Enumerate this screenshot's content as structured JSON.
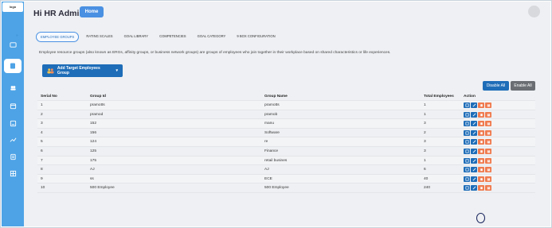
{
  "brand": {
    "label": "logo"
  },
  "header": {
    "title": "Hi HR Admin",
    "home_label": "Home"
  },
  "tabs": [
    {
      "label": "EMPLOYEE GROUPS",
      "active": true
    },
    {
      "label": "RATING SCALES",
      "active": false
    },
    {
      "label": "GOAL LIBRARY",
      "active": false
    },
    {
      "label": "COMPETENCIES",
      "active": false
    },
    {
      "label": "GOAL CATEGORY",
      "active": false
    },
    {
      "label": "9 BOX CONFIGURATION",
      "active": false
    }
  ],
  "collapse_label": "»",
  "description": "Employee resource groups (also known as ERGs, affinity groups, or business network groups) are groups of employees who join together in their workplace based on shared characteristics or life experiences.",
  "add_group_label": "Add Target Employees Group",
  "disable_all_label": "Disable All",
  "enable_all_label": "Enable All",
  "table": {
    "headers": {
      "serial": "Serial No",
      "group_id": "Group Id",
      "group_name": "Group Name",
      "total": "Total Employees",
      "action": "Action"
    },
    "rows": [
      {
        "serial": "1",
        "group_id": "pramotts",
        "group_name": "pramotts",
        "total": "1"
      },
      {
        "serial": "2",
        "group_id": "pramod",
        "group_name": "pramob",
        "total": "1"
      },
      {
        "serial": "3",
        "group_id": "152",
        "group_name": "manu",
        "total": "3"
      },
      {
        "serial": "4",
        "group_id": "156",
        "group_name": "Software",
        "total": "2"
      },
      {
        "serial": "5",
        "group_id": "124",
        "group_name": "re",
        "total": "3"
      },
      {
        "serial": "6",
        "group_id": "125",
        "group_name": "Finance",
        "total": "3"
      },
      {
        "serial": "7",
        "group_id": "175",
        "group_name": "retail busines",
        "total": "1"
      },
      {
        "serial": "8",
        "group_id": "AJ",
        "group_name": "AJ",
        "total": "6"
      },
      {
        "serial": "9",
        "group_id": "ss",
        "group_name": "ECE",
        "total": "40"
      },
      {
        "serial": "10",
        "group_id": "500 Employee",
        "group_name": "500 Employee",
        "total": "240"
      }
    ]
  },
  "colors": {
    "primary": "#1e6db8",
    "accent": "#4a90e2",
    "rail": "#4ea3e6",
    "danger": "#f07b4f"
  }
}
